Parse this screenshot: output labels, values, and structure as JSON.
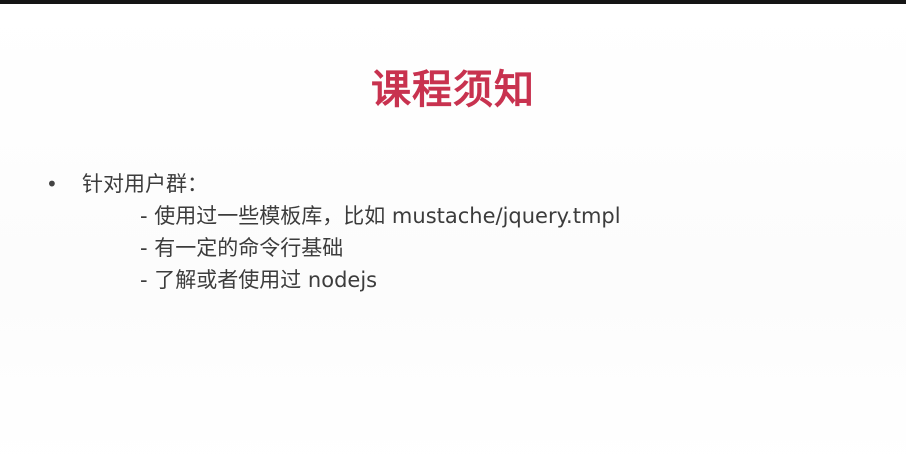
{
  "slide": {
    "title": "课程须知",
    "bullet": {
      "marker": "•",
      "text": "针对用户群："
    },
    "sub_items": [
      "- 使用过一些模板库，比如 mustache/jquery.tmpl",
      "- 有一定的命令行基础",
      "- 了解或者使用过 nodejs"
    ],
    "colors": {
      "title": "#c8324f",
      "text": "#3c3c3c",
      "top_bar": "#151515"
    }
  }
}
